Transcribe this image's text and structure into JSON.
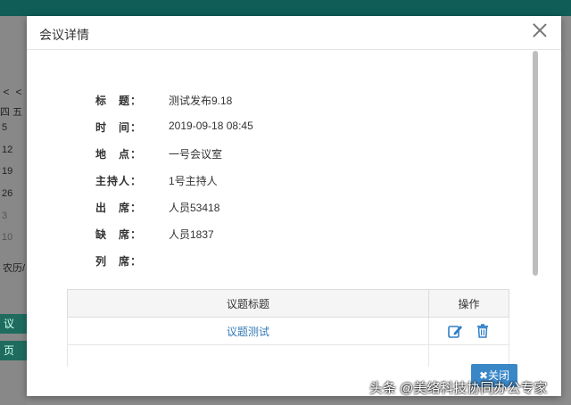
{
  "background": {
    "calendar_nav": [
      "<",
      "<"
    ],
    "week_header": "四 五",
    "days": [
      "5",
      "12",
      "19",
      "26",
      "3",
      "10"
    ],
    "lunar_label": "农历/",
    "side_buttons": [
      "议",
      "页"
    ]
  },
  "modal": {
    "title": "会议详情",
    "fields": [
      {
        "label": "标　题：",
        "value": "测试发布9.18"
      },
      {
        "label": "时　间：",
        "value": "2019-09-18 08:45"
      },
      {
        "label": "地　点：",
        "value": "一号会议室"
      },
      {
        "label": "主持人：",
        "value": "1号主持人"
      },
      {
        "label": "出　席：",
        "value": "人员53418"
      },
      {
        "label": "缺　席：",
        "value": "人员1837"
      },
      {
        "label": "列　席：",
        "value": ""
      }
    ],
    "table": {
      "headers": [
        "议题标题",
        "操作"
      ],
      "rows": [
        {
          "title": "议题测试"
        }
      ]
    },
    "close_button": "✖关闭"
  },
  "watermark": "头条 @美络科技协同办公专家",
  "colors": {
    "link": "#337ab7",
    "primary_button": "#3a87c8",
    "topbar": "#0f5d56"
  }
}
